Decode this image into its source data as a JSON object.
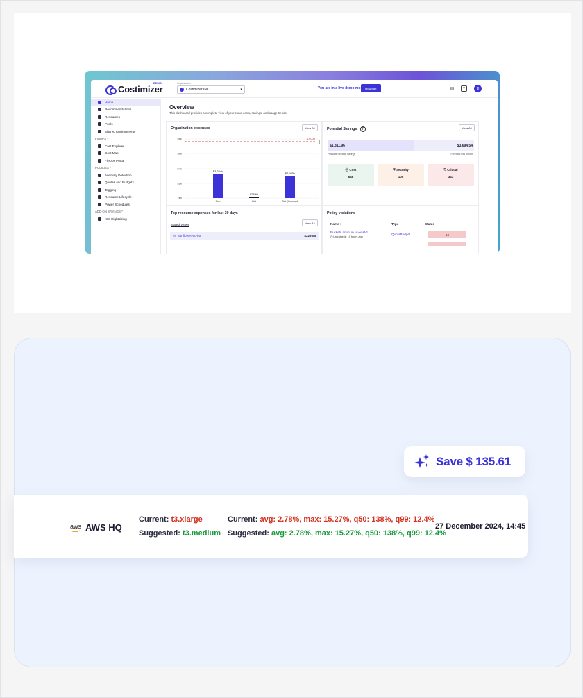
{
  "app": {
    "logo_text": "Costimizer",
    "demo_badge": "DEMO",
    "org_label": "Organization",
    "org_value": "Costimizer INC",
    "live_text": "You are in a live demo mode",
    "register_label": "Register",
    "avatar_letter": "D"
  },
  "sidebar": {
    "items": [
      {
        "label": "Home",
        "active": true
      },
      {
        "label": "Recommendations"
      },
      {
        "label": "Resources"
      },
      {
        "label": "Pools"
      },
      {
        "label": "Shared Environments"
      }
    ],
    "finops_label": "FINOPS ^",
    "finops_items": [
      "Cost Explorer",
      "Cost Map",
      "FinOps Portal"
    ],
    "policies_label": "POLICIES ^",
    "policies_items": [
      "Anomaly Detection",
      "Quotas and Budgets",
      "Tagging",
      "Resource Lifecycle",
      "Power Schedules"
    ],
    "addon_label": "ADD-ON SAVINGS ^",
    "addon_items": [
      "K8s Rightsizing"
    ]
  },
  "overview": {
    "title": "Overview",
    "description": "This dashboard provides a complete view of your cloud costs, savings, and usage trends."
  },
  "expenses": {
    "title": "Organization expenses",
    "view_all": "View All",
    "y_ticks": [
      "$6k",
      "$4k",
      "$2k",
      "$0"
    ],
    "y_extra_tick": "$6k",
    "forecast_line_label": "$7,000",
    "bars": [
      {
        "label": "Sep",
        "value": 3254,
        "text": "$3,254k"
      },
      {
        "label": "Oct",
        "value": 76.61,
        "text": "$76.61"
      },
      {
        "label": "Oct (forecast)",
        "value": 2.985,
        "text": "$2,985k"
      }
    ]
  },
  "savings": {
    "title": "Potential Savings",
    "view_all": "View All",
    "possible_value": "$1,811.96",
    "possible_caption": "Possible monthly savings",
    "forecast_value": "$3,694.54",
    "forecast_caption": "Forecast this month",
    "fill_fraction": 0.59,
    "tiles": [
      {
        "label": "Cost",
        "value": "595",
        "bg": "#eaf5ef"
      },
      {
        "label": "Security",
        "value": "105",
        "bg": "#fdf0e6"
      },
      {
        "label": "Critical",
        "value": "341",
        "bg": "#fbe8e8"
      }
    ]
  },
  "top_resources": {
    "title": "Top resource expenses for last 30 days",
    "saved_views": "Saved Views",
    "view_all": "View All",
    "row_name": "sunflower-eu-fra",
    "row_amount": "$229.05"
  },
  "policy": {
    "title": "Policy violations",
    "col_name": "Name ↑",
    "col_type": "Type",
    "col_status": "Status",
    "row_name": "Buckets count in us-east-1",
    "row_sub": "Last check: 10 hours ago",
    "row_type": "QuotaBudget",
    "row_status": "13"
  },
  "recommendation": {
    "save_label": "Save $ 135.61",
    "provider_logo": "aws",
    "account_name": "AWS HQ",
    "current_label": "Current:",
    "current_instance": "t3.xlarge",
    "suggested_label": "Suggested:",
    "suggested_instance": "t3.medium",
    "current_metrics_label": "Current:",
    "current_metrics": "avg: 2.78%, max: 15.27%, q50: 138%, q99: 12.4%",
    "suggested_metrics_label": "Suggested:",
    "suggested_metrics": "avg: 2.78%, max: 15.27%, q50: 138%, q99: 12.4%",
    "date": "27 December 2024, 14:45"
  },
  "colors": {
    "accent": "#3b33d8",
    "red": "#d42f1f",
    "green": "#199a3a"
  }
}
